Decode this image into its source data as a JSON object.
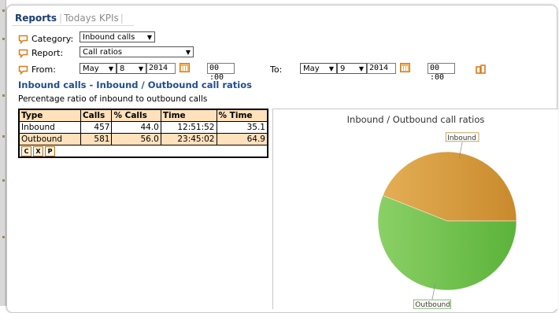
{
  "tabs": [
    {
      "label": "Reports",
      "active": true
    },
    {
      "label": "Todays KPIs",
      "active": false
    }
  ],
  "form": {
    "category_label": "Category:",
    "category_value": "Inbound calls",
    "report_label": "Report:",
    "report_value": "Call ratios",
    "from_label": "From:",
    "from_month": "May",
    "from_day": "8",
    "from_year": "2014",
    "from_time": "00 :00",
    "to_label": "To:",
    "to_month": "May",
    "to_day": "9",
    "to_year": "2014",
    "to_time": "00 :00"
  },
  "report": {
    "heading": "Inbound calls - Inbound / Outbound call ratios",
    "subtitle": "Percentage ratio of inbound to outbound calls",
    "columns": [
      "Type",
      "Calls",
      "% Calls",
      "Time",
      "% Time"
    ],
    "rows": [
      [
        "Inbound",
        "457",
        "44.0",
        "12:51:52",
        "35.1"
      ],
      [
        "Outbound",
        "581",
        "56.0",
        "23:45:02",
        "64.9"
      ]
    ],
    "export_buttons": [
      "C",
      "X",
      "P"
    ]
  },
  "colors": {
    "inbound": "#d99a3c",
    "outbound": "#6cbf4a",
    "header_fill": "#ffe1bc",
    "heading_text": "#1f4f8a"
  },
  "chart_data": {
    "type": "pie",
    "title": "Inbound / Outbound call ratios",
    "categories": [
      "Inbound",
      "Outbound"
    ],
    "values": [
      44.0,
      56.0
    ]
  }
}
